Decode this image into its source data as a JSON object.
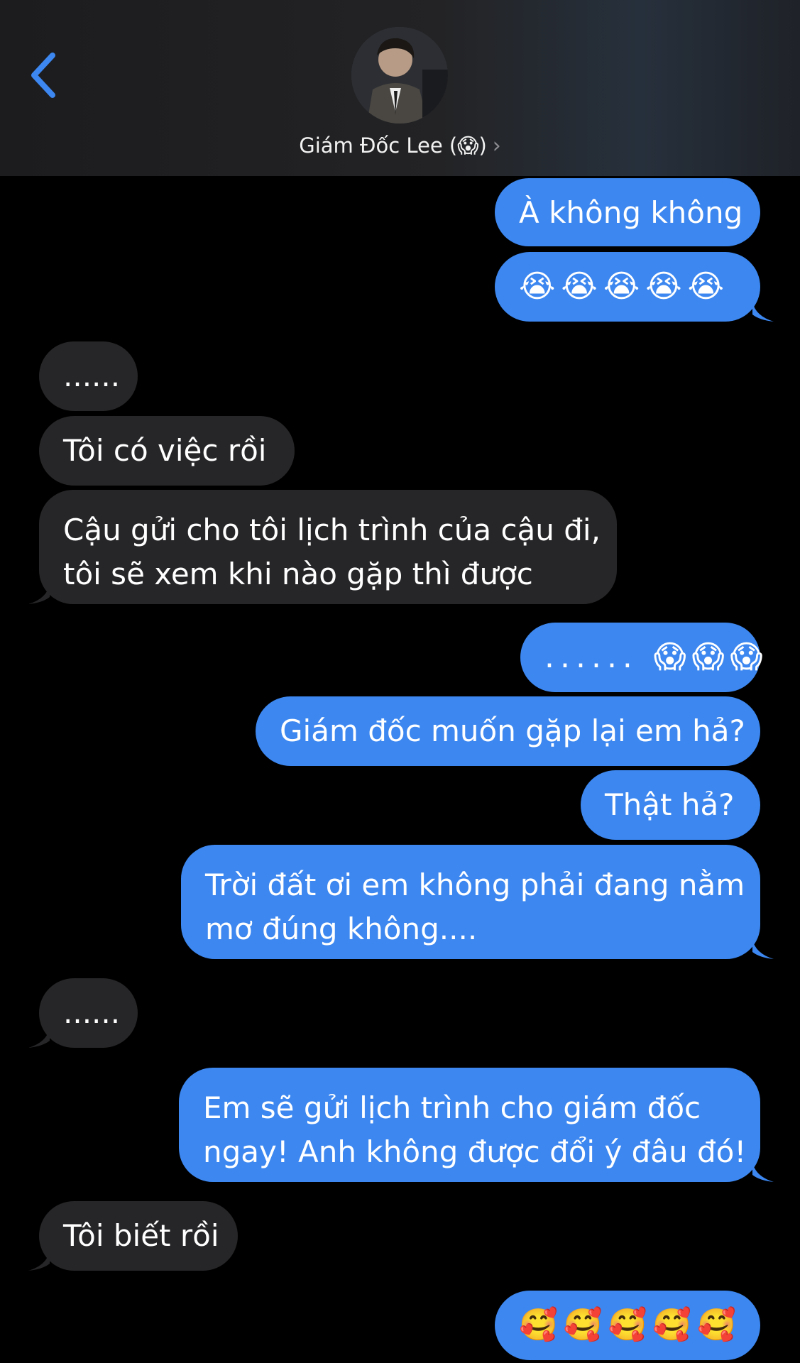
{
  "header": {
    "contact_name": "Giám Đốc Lee (😱)",
    "chevron": "›",
    "back_icon": "chevron-left-icon",
    "accent_color": "#3c87f0"
  },
  "messages": [
    {
      "side": "sent",
      "text": "À không không"
    },
    {
      "side": "sent",
      "text": "😭😭😭😭😭"
    },
    {
      "side": "received",
      "text": "......"
    },
    {
      "side": "received",
      "text": "Tôi có việc rồi"
    },
    {
      "side": "received",
      "line1": "Cậu gửi cho tôi lịch trình của cậu đi,",
      "line2": "tôi sẽ xem khi nào gặp thì được"
    },
    {
      "side": "sent",
      "text": "...... 😱😱😱"
    },
    {
      "side": "sent",
      "text": "Giám đốc muốn gặp lại em hả?"
    },
    {
      "side": "sent",
      "text": "Thật hả?"
    },
    {
      "side": "sent",
      "line1": "Trời đất ơi em không phải đang nằm",
      "line2": "mơ đúng không...."
    },
    {
      "side": "received",
      "text": "......"
    },
    {
      "side": "sent",
      "line1": "Em sẽ gửi lịch trình cho giám đốc",
      "line2": "ngay! Anh không được đổi ý đâu đó!"
    },
    {
      "side": "received",
      "text": "Tôi biết rồi"
    },
    {
      "side": "sent",
      "text": "🥰🥰🥰🥰🥰"
    }
  ]
}
